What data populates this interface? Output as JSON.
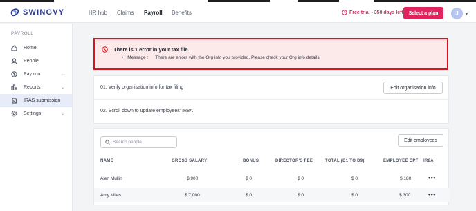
{
  "app": {
    "brand": "SWINGVY",
    "nav": [
      "HR hub",
      "Claims",
      "Payroll",
      "Benefits"
    ],
    "trial_text": "Free trial - 350 days left",
    "plan_button": "Select a plan",
    "avatar_initial": "J"
  },
  "sidebar": {
    "heading": "PAYROLL",
    "items": [
      {
        "label": "Home",
        "icon": "home-icon"
      },
      {
        "label": "People",
        "icon": "person-icon"
      },
      {
        "label": "Pay run",
        "icon": "money-icon"
      },
      {
        "label": "Reports",
        "icon": "chart-icon"
      },
      {
        "label": "IRAS submission",
        "icon": "document-icon"
      },
      {
        "label": "Settings",
        "icon": "gear-icon"
      }
    ]
  },
  "error": {
    "title": "There is 1 error in your tax file.",
    "message_label": "Message :",
    "message_text": "There are errors with the Org info you provided. Please check your Org info details."
  },
  "steps": {
    "step1": "01. Verify organisation info for tax filing",
    "step1_button": "Edit organisation info",
    "step2": "02. Scroll down to update employees' IR8A"
  },
  "employees": {
    "search_placeholder": "Search people",
    "edit_button": "Edit employees",
    "columns": [
      "NAME",
      "GROSS SALARY",
      "BONUS",
      "DIRECTOR'S FEE",
      "TOTAL (D1 TO D9)",
      "EMPLOYEE CPF",
      "IR8A"
    ],
    "rows": [
      {
        "name": "Alen Mullin",
        "gross": "$ 900",
        "bonus": "$ 0",
        "director_fee": "$ 0",
        "total": "$ 0",
        "cpf": "$ 180",
        "action": "•••"
      },
      {
        "name": "Amy Miles",
        "gross": "$ 7,000",
        "bonus": "$ 0",
        "director_fee": "$ 0",
        "total": "$ 0",
        "cpf": "$ 300",
        "action": "•••"
      }
    ]
  },
  "colors": {
    "accent": "#e0245e",
    "error_border": "#e0101c",
    "brand": "#2b3c8f"
  }
}
